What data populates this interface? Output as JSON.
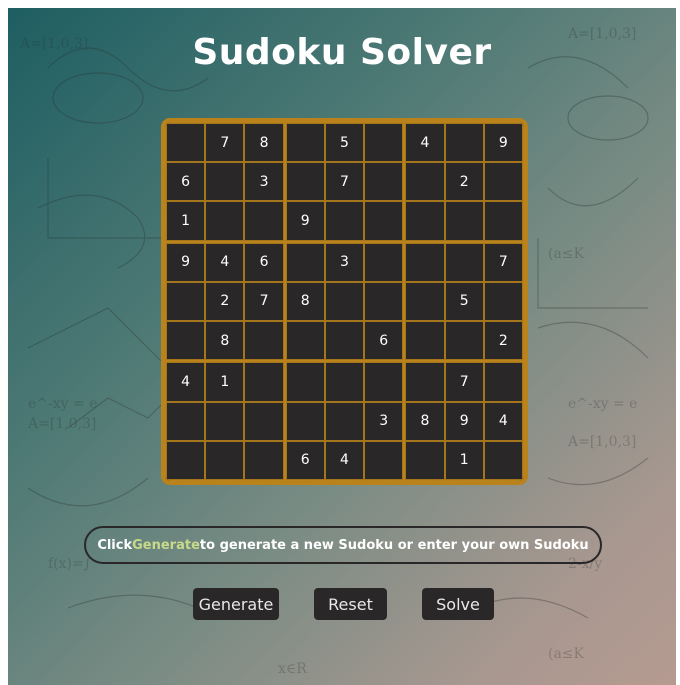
{
  "title": "Sudoku Solver",
  "grid": [
    [
      "",
      "7",
      "8",
      "",
      "5",
      "",
      "4",
      "",
      "9"
    ],
    [
      "6",
      "",
      "3",
      "",
      "7",
      "",
      "",
      "2",
      ""
    ],
    [
      "1",
      "",
      "",
      "9",
      "",
      "",
      "",
      "",
      ""
    ],
    [
      "9",
      "4",
      "6",
      "",
      "3",
      "",
      "",
      "",
      "7"
    ],
    [
      "",
      "2",
      "7",
      "8",
      "",
      "",
      "",
      "5",
      ""
    ],
    [
      "",
      "8",
      "",
      "",
      "",
      "6",
      "",
      "",
      "2"
    ],
    [
      "4",
      "1",
      "",
      "",
      "",
      "",
      "",
      "7",
      ""
    ],
    [
      "",
      "",
      "",
      "",
      "",
      "3",
      "8",
      "9",
      "4"
    ],
    [
      "",
      "",
      "",
      "6",
      "4",
      "",
      "",
      "1",
      ""
    ]
  ],
  "instruction": {
    "prefix": "Click ",
    "highlight": "Generate",
    "suffix": " to generate a new Sudoku or enter your own Sudoku"
  },
  "buttons": {
    "generate": "Generate",
    "reset": "Reset",
    "solve": "Solve"
  },
  "colors": {
    "accent": "#b9821a",
    "board_bg": "#2a2728",
    "highlight": "#c9d98a"
  }
}
